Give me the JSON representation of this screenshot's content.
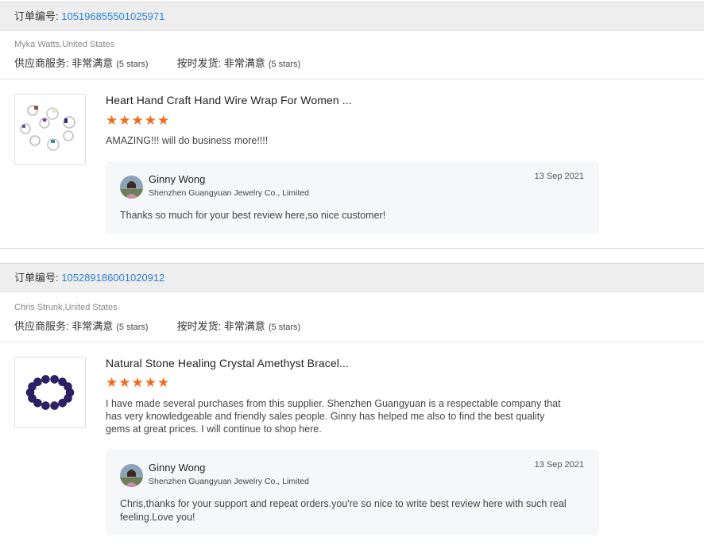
{
  "orders": [
    {
      "order_label": "订单编号: ",
      "order_number": "105196855501025971",
      "buyer": "Myka Watts,United States",
      "supplier_service_label": "供应商服务: 非常满意",
      "supplier_service_stars": "(5 stars)",
      "shipping_label": "按时发货: 非常满意",
      "shipping_stars": "(5 stars)",
      "product_title": "Heart Hand Craft Hand Wire Wrap For Women ...",
      "product_image_icon": "rings-product-thumbnail",
      "rating": 5,
      "stars_text": "★★★★★",
      "review": "AMAZING!!! will do business more!!!!",
      "reply": {
        "name": "Ginny Wong",
        "company": "Shenzhen Guangyuan Jewelry Co., Limited",
        "date": "13 Sep 2021",
        "text": "Thanks so much for your best review here,so nice customer!"
      }
    },
    {
      "order_label": "订单编号: ",
      "order_number": "105289186001020912",
      "buyer": "Chris Strunk,United States",
      "supplier_service_label": "供应商服务: 非常满意",
      "supplier_service_stars": "(5 stars)",
      "shipping_label": "按时发货: 非常满意",
      "shipping_stars": "(5 stars)",
      "product_title": "Natural Stone Healing Crystal Amethyst Bracel...",
      "product_image_icon": "bracelet-product-thumbnail",
      "rating": 5,
      "stars_text": "★★★★★",
      "review": "I have made several purchases from this supplier.  Shenzhen Guangyuan is a respectable company that has very knowledgeable and friendly sales people.  Ginny has helped me also to find the best quality gems at great prices.  I will continue to shop here.",
      "reply": {
        "name": "Ginny Wong",
        "company": "Shenzhen Guangyuan Jewelry Co., Limited",
        "date": "13 Sep 2021",
        "text": "Chris,thanks for your support and repeat orders.you're so nice to write best review here with such real feeling.Love you!"
      }
    }
  ],
  "colors": {
    "star": "#f26a1b",
    "order_number": "#2f7fd0",
    "header_bg": "#eeeeee",
    "reply_bg": "#f6f7f8"
  }
}
